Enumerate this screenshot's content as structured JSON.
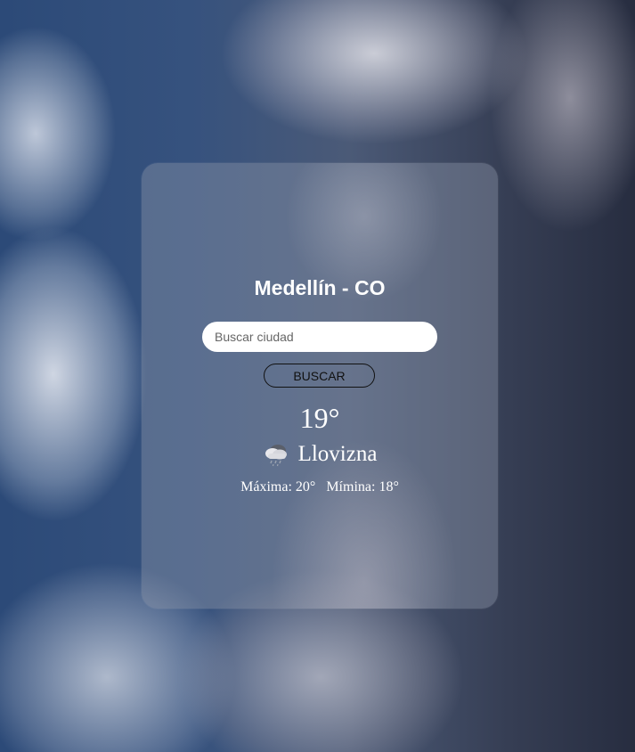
{
  "weather": {
    "city": "Medellín - CO",
    "search": {
      "placeholder": "Buscar ciudad",
      "value": ""
    },
    "button_label": "BUSCAR",
    "temperature": "19°",
    "condition_icon": "cloud-drizzle-icon",
    "condition": "Llovizna",
    "max": "Máxima: 20°",
    "min": "Mímina: 18°"
  }
}
